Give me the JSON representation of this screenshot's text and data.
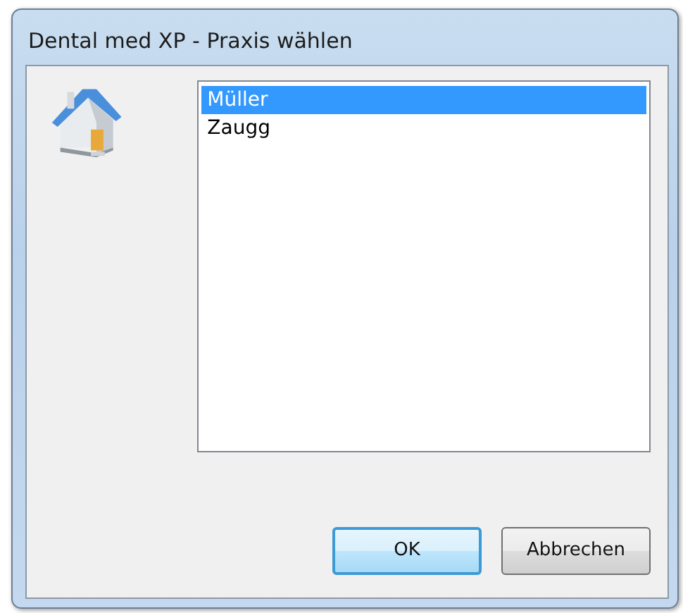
{
  "window": {
    "title": "Dental med XP - Praxis wählen"
  },
  "list": {
    "items": [
      {
        "label": "Müller",
        "selected": true
      },
      {
        "label": "Zaugg",
        "selected": false
      }
    ]
  },
  "buttons": [
    {
      "label": "OK",
      "kind": "default"
    },
    {
      "label": "Abbrechen",
      "kind": "normal"
    }
  ]
}
